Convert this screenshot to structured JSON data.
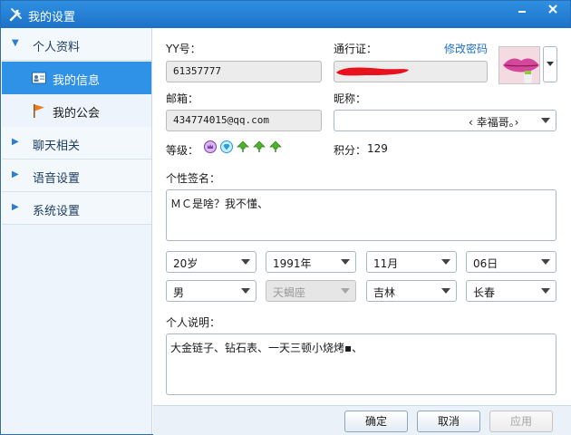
{
  "window": {
    "title": "我的设置"
  },
  "sidebar": {
    "groups": [
      {
        "label": "个人资料",
        "expanded": true
      },
      {
        "label": "聊天相关",
        "expanded": false
      },
      {
        "label": "语音设置",
        "expanded": false
      },
      {
        "label": "系统设置",
        "expanded": false
      }
    ],
    "items": [
      {
        "label": "我的信息",
        "active": true,
        "icon": "id-card-icon"
      },
      {
        "label": "我的公会",
        "active": false,
        "icon": "flag-icon"
      }
    ]
  },
  "profile": {
    "yy_label": "YY号：",
    "yy_value": "61357777",
    "passport_label": "通行证：",
    "passport_value": "",
    "change_password": "修改密码",
    "email_label": "邮箱：",
    "email_value": "434774015@qq.com",
    "nickname_label": "昵称：",
    "nickname_value": "‹ 幸福哥｡›",
    "level_label": "等级：",
    "points_label": "积分：",
    "points_value": "129",
    "signature_label": "个性签名：",
    "signature_value": "ＭＣ是啥？我不懂、",
    "age": "20岁",
    "birth_year": "1991年",
    "birth_month": "11月",
    "birth_day": "06日",
    "gender": "男",
    "zodiac": "天蝎座",
    "province": "吉林",
    "city": "长春",
    "intro_label": "个人说明：",
    "intro_value": "大金链子、钻石表、一天三顿小烧烤▪、"
  },
  "buttons": {
    "ok": "确定",
    "cancel": "取消",
    "apply": "应用"
  },
  "colors": {
    "titlebar": "#1d72c8",
    "accent": "#2f92e6",
    "link": "#1f6fc5",
    "redaction": "#e8121e"
  }
}
